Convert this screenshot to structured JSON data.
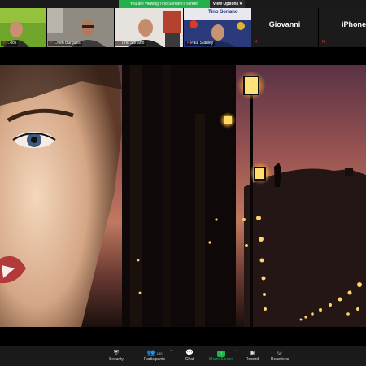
{
  "meeting": {
    "viewing_text": "You are viewing Tino Soriano's screen",
    "view_options_label": "View Options ▾"
  },
  "gallery": {
    "tiles": [
      {
        "name": "...ook"
      },
      {
        "name": "...nén Burgues"
      },
      {
        "name": "Tino Soriano"
      },
      {
        "name": "Paul Stanley",
        "overlay_text": "Tino Soriano"
      },
      {
        "name": "Giovanni"
      },
      {
        "name": "iPhone"
      }
    ]
  },
  "toolbar": {
    "security": "Security",
    "participants": "Participants",
    "participants_count": "190",
    "chat": "Chat",
    "share_screen": "Share Screen",
    "record": "Record",
    "reactions": "Reactions"
  },
  "icons": {
    "security": "shield-icon",
    "participants": "people-icon",
    "chat": "chat-bubble-icon",
    "share_screen": "share-arrow-icon",
    "record": "record-icon",
    "reactions": "reaction-icon"
  },
  "colors": {
    "accent_green": "#22b14c",
    "muted_red": "#e33333",
    "toolbar_bg": "#1a1a1a"
  }
}
